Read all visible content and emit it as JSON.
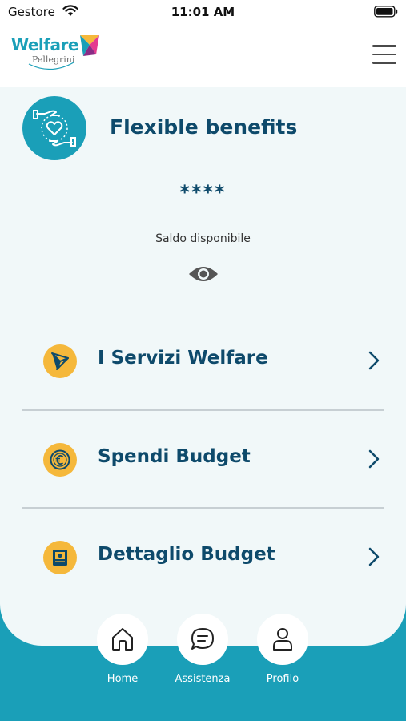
{
  "status_bar": {
    "carrier": "Gestore",
    "time": "11:01 AM",
    "wifi_icon": "wifi-icon",
    "battery_icon": "battery-icon"
  },
  "header": {
    "logo_word": "Welfare",
    "logo_sub": "Pellegrini",
    "menu_icon": "hamburger-menu-icon"
  },
  "hero": {
    "title": "Flexible benefits",
    "icon": "hands-heart-icon"
  },
  "balance": {
    "value": "****",
    "label": "Saldo disponibile",
    "toggle_icon": "eye-icon"
  },
  "menu": [
    {
      "label": "I Servizi Welfare",
      "icon": "kite-icon"
    },
    {
      "label": "Spendi Budget",
      "icon": "euro-coin-icon"
    },
    {
      "label": "Dettaglio Budget",
      "icon": "budget-book-icon"
    }
  ],
  "nav": [
    {
      "label": "Home",
      "icon": "home-icon"
    },
    {
      "label": "Assistenza",
      "icon": "chat-icon"
    },
    {
      "label": "Profilo",
      "icon": "user-icon"
    }
  ],
  "colors": {
    "teal": "#1a9fb8",
    "navy": "#0e4a6b",
    "gold": "#f5b83b",
    "card_bg": "#f1f8f9"
  }
}
